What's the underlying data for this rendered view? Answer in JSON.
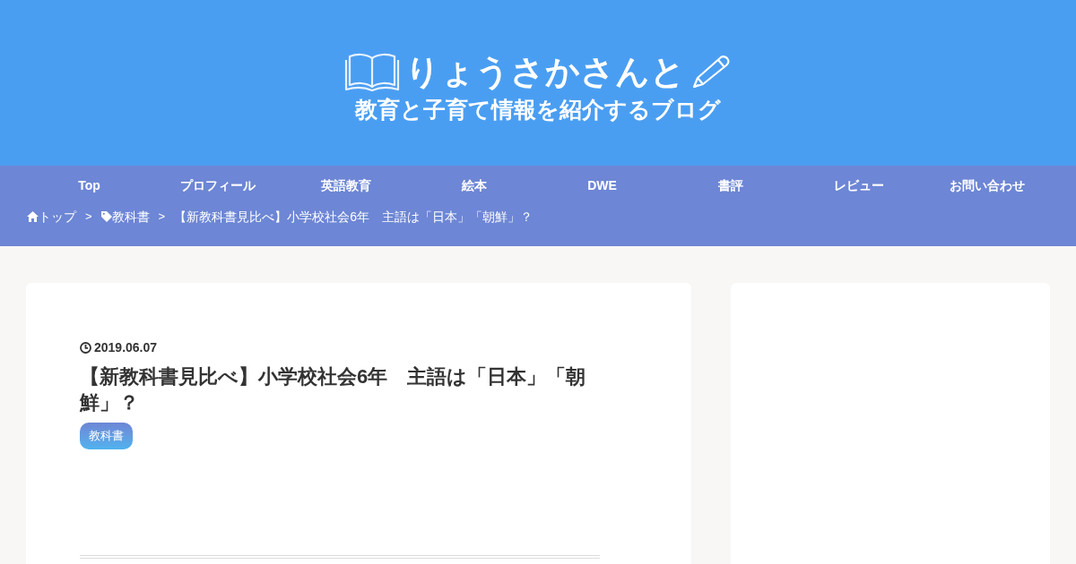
{
  "header": {
    "logo": {
      "title": "りょうさかさんと",
      "subtitle": "教育と子育て情報を紹介するブログ"
    }
  },
  "nav": {
    "items": [
      {
        "label": "Top"
      },
      {
        "label": "プロフィール"
      },
      {
        "label": "英語教育"
      },
      {
        "label": "絵本"
      },
      {
        "label": "DWE"
      },
      {
        "label": "書評"
      },
      {
        "label": "レビュー"
      },
      {
        "label": "お問い合わせ"
      }
    ]
  },
  "breadcrumb": {
    "items": [
      {
        "kind": "home",
        "label": "トップ",
        "separator": ">"
      },
      {
        "kind": "tag",
        "label": "教科書",
        "separator": ">"
      },
      {
        "kind": "page",
        "label": "【新教科書見比べ】小学校社会6年　主語は「日本」「朝鮮」？"
      }
    ]
  },
  "article": {
    "date": "2019.06.07",
    "title": "【新教科書見比べ】小学校社会6年　主語は「日本」「朝鮮」？",
    "tags": [
      "教科書"
    ]
  }
}
